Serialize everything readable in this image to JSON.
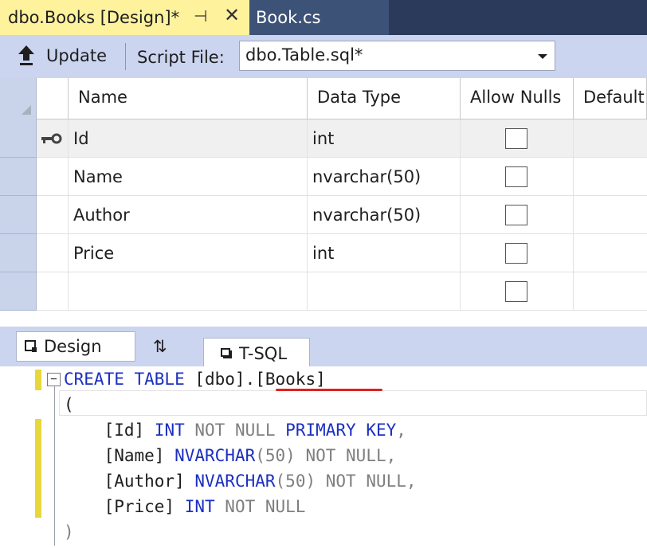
{
  "tabs": {
    "active": {
      "label": "dbo.Books [Design]*",
      "pin": "⊣",
      "close": "✕"
    },
    "inactive": {
      "label": "Book.cs"
    }
  },
  "toolbar": {
    "update_label": "Update",
    "script_file_label": "Script File:",
    "script_file_value": "dbo.Table.sql*"
  },
  "grid": {
    "columns": [
      "Name",
      "Data Type",
      "Allow Nulls",
      "Default"
    ],
    "rows": [
      {
        "name": "Id",
        "type": "int",
        "allow_nulls": false,
        "primary_key": true
      },
      {
        "name": "Name",
        "type": "nvarchar(50)",
        "allow_nulls": false,
        "primary_key": false
      },
      {
        "name": "Author",
        "type": "nvarchar(50)",
        "allow_nulls": false,
        "primary_key": false
      },
      {
        "name": "Price",
        "type": "int",
        "allow_nulls": false,
        "primary_key": false
      },
      {
        "name": "",
        "type": "",
        "allow_nulls": false,
        "primary_key": false
      }
    ]
  },
  "view_tabs": {
    "design": "Design",
    "swap": "⇅",
    "tsql": "T-SQL"
  },
  "code": {
    "line1_kw": "CREATE TABLE",
    "line1_rest": " [dbo].",
    "line1_name": "[Books]",
    "line2": "(",
    "line3_a": "    [Id] ",
    "line3_kw1": "INT",
    "line3_gr": " NOT NULL ",
    "line3_kw2": "PRIMARY KEY",
    "line3_end": ",",
    "line4_a": "    [Name] ",
    "line4_kw": "NVARCHAR",
    "line4_b": "(50)",
    "line4_gr": " NOT NULL",
    "line4_end": ",",
    "line5_a": "    [Author] ",
    "line5_kw": "NVARCHAR",
    "line5_b": "(50)",
    "line5_gr": " NOT NULL",
    "line5_end": ",",
    "line6_a": "    [Price] ",
    "line6_kw": "INT",
    "line6_gr": " NOT NULL",
    "line7": ")"
  },
  "colors": {
    "active_tab": "#fff29d",
    "tab_strip": "#2b3a5a",
    "toolbar": "#ccd5f0",
    "keyword": "#1b2fc0",
    "change_marker": "#e8d73a",
    "squiggle": "#e02020"
  }
}
